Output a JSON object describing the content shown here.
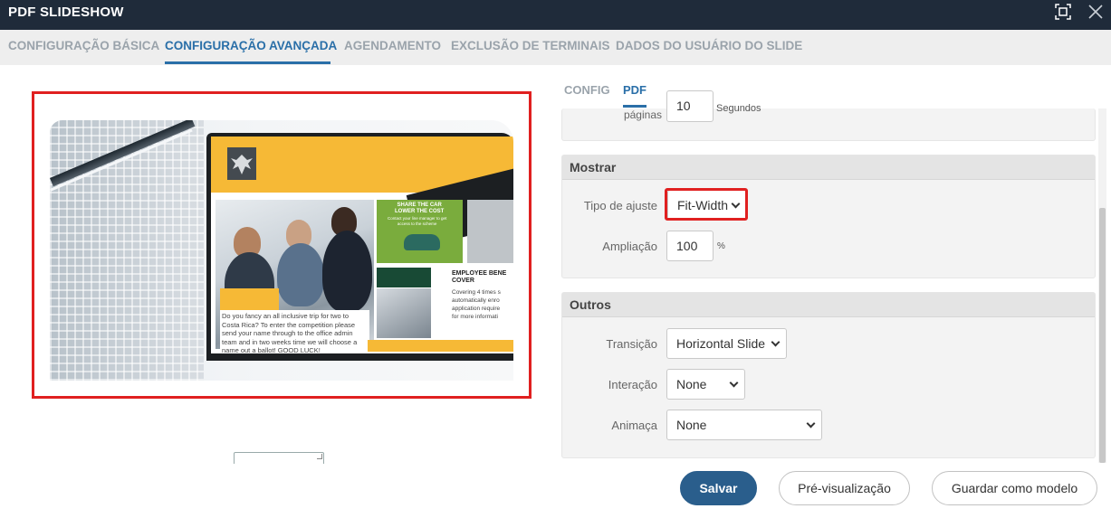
{
  "window": {
    "title": "PDF SLIDESHOW"
  },
  "tabs": [
    {
      "label": "CONFIGURAÇÃO BÁSICA",
      "active": false
    },
    {
      "label": "CONFIGURAÇÃO AVANÇADA",
      "active": true
    },
    {
      "label": "AGENDAMENTO",
      "active": false
    },
    {
      "label": "EXCLUSÃO DE TERMINAIS",
      "active": false
    },
    {
      "label": "DADOS DO USUÁRIO DO SLIDE",
      "active": false
    }
  ],
  "preview": {
    "slide_texts": {
      "green_title": "SHARE THE CAR\nLOWER THE COST",
      "green_sub": "Contact your line manager to get\naccess to the scheme",
      "employee_title": "EMPLOYEE BENE\nCOVER",
      "employee_text": "Covering 4 times s\nautomatically enro\napplication require\nfor more informati",
      "competition": "Do you fancy an all inclusive trip for two to Costa Rica? To enter the competition please send your name through to the office admin team and in two weeks time we will choose a name out a ballot! GOOD LUCK!"
    }
  },
  "subtabs": [
    {
      "label": "CONFIG",
      "active": false
    },
    {
      "label": "PDF",
      "active": true
    }
  ],
  "timing": {
    "label": "páginas",
    "value": "10",
    "unit": "Segundos"
  },
  "mostrar": {
    "header": "Mostrar",
    "fit_label": "Tipo de ajuste",
    "fit_value": "Fit-Width",
    "zoom_label": "Ampliação",
    "zoom_value": "100",
    "zoom_unit": "%"
  },
  "outros": {
    "header": "Outros",
    "transition_label": "Transição",
    "transition_value": "Horizontal Slide",
    "interaction_label": "Interação",
    "interaction_value": "None",
    "animation_label": "Animaça",
    "animation_value": "None"
  },
  "footer": {
    "save": "Salvar",
    "preview": "Pré-visualização",
    "save_template": "Guardar como modelo"
  },
  "colors": {
    "titlebar": "#1f2b3a",
    "accent": "#2a6fa8",
    "primary_button": "#2a5e8c",
    "highlight": "#e02020"
  }
}
